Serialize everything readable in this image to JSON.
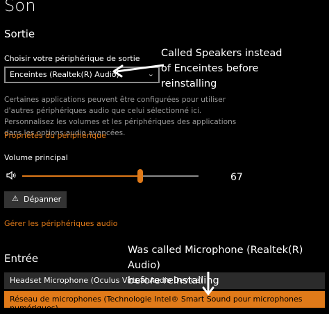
{
  "page": {
    "title": "Son"
  },
  "output": {
    "heading": "Sortie",
    "device_label": "Choisir votre périphérique de sortie",
    "device_value": "Enceintes (Realtek(R) Audio)",
    "description": "Certaines applications peuvent être configurées pour utiliser d'autres périphériques audio que celui sélectionné ici. Personnalisez les volumes et les périphériques des applications dans les options audio avancées.",
    "properties_link": "Propriétés du périphérique",
    "volume_label": "Volume principal",
    "volume_value": 67,
    "volume_text": "67",
    "troubleshoot_label": "Dépanner",
    "manage_link": "Gérer les périphériques audio"
  },
  "input": {
    "heading": "Entrée",
    "devices": [
      {
        "label": "Headset Microphone (Oculus Virtual Audio Device)"
      },
      {
        "label": "Réseau de microphones (Technologie Intel® Smart Sound pour microphones numériques)"
      }
    ]
  },
  "annotations": {
    "speakers_note": {
      "line1": "Called Speakers instead",
      "line2": "of Enceintes before",
      "line3": "reinstalling"
    },
    "microphone_note": {
      "line1": "Was called Microphone (Realtek(R) Audio)",
      "line2": "before reinstalling"
    }
  },
  "colors": {
    "accent": "#e07a19",
    "background": "#000000",
    "muted_text": "#9a9a9a"
  },
  "icons": {
    "volume": "speaker-icon",
    "dropdown": "chevron-down-icon",
    "troubleshoot": "wrench-icon"
  }
}
